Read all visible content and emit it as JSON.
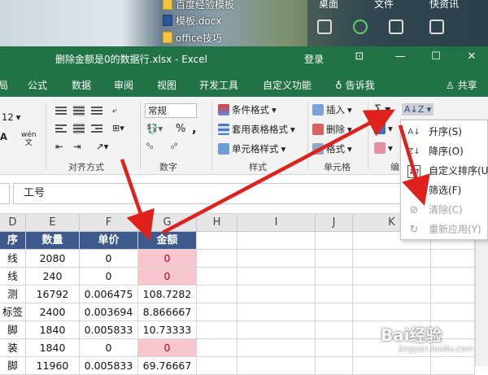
{
  "desktop": {
    "files": [
      "百度经验模板",
      "模板.docx",
      "office技巧"
    ],
    "widget_tabs": [
      "桌面",
      "文件",
      "快资讯"
    ]
  },
  "window": {
    "title": "删除金额是0的数据行.xlsx  -  Excel",
    "login": "登录"
  },
  "tabs": [
    "局",
    "公式",
    "数据",
    "审阅",
    "视图",
    "开发工具",
    "自定义功能",
    "告诉我",
    "共享"
  ],
  "ribbon": {
    "font_size_value": "12",
    "wen_label": "wén",
    "wen_sub": "文",
    "alignment_label": "对齐方式",
    "number_format": "常规",
    "percent": "%",
    "comma": ",",
    "number_label": "数字",
    "conditional_format": "条件格式",
    "table_format": "套用表格格式",
    "cell_style": "单元格样式",
    "styles_label": "样式",
    "insert": "插入",
    "delete": "删除",
    "format": "格式",
    "cells_label": "单元格",
    "editing_label": "编"
  },
  "formula_bar": {
    "value": "工号"
  },
  "grid": {
    "columns": [
      "D",
      "E",
      "F",
      "G",
      "H",
      "I",
      "J",
      "K"
    ],
    "header_row": [
      "序",
      "数量",
      "单价",
      "金额"
    ],
    "rows": [
      [
        "线",
        "2080",
        "0",
        "0"
      ],
      [
        "线",
        "240",
        "0",
        "0"
      ],
      [
        "测",
        "16792",
        "0.006475",
        "108.7282"
      ],
      [
        "标签",
        "2400",
        "0.003694",
        "8.866667"
      ],
      [
        "脚",
        "1840",
        "0.005833",
        "10.73333"
      ],
      [
        "装",
        "1840",
        "0",
        "0"
      ],
      [
        "脚",
        "11960",
        "0.005833",
        "69.76667"
      ]
    ]
  },
  "sort_menu": {
    "items": [
      {
        "label": "升序(S)",
        "icon": "sort-asc-icon",
        "enabled": true
      },
      {
        "label": "降序(O)",
        "icon": "sort-desc-icon",
        "enabled": true
      },
      {
        "label": "自定义排序(U)",
        "icon": "custom-sort-icon",
        "enabled": true
      },
      {
        "label": "筛选(F)",
        "icon": "filter-icon",
        "enabled": true
      },
      {
        "label": "清除(C)",
        "icon": "clear-filter-icon",
        "enabled": false
      },
      {
        "label": "重新应用(Y)",
        "icon": "reapply-icon",
        "enabled": false
      }
    ]
  },
  "watermark": {
    "text": "Bai经验",
    "sub": "jingyan.baidu.com"
  },
  "colors": {
    "excel_green": "#217346",
    "header_blue": "#3e5a8c",
    "zero_highlight": "#f8c6cf",
    "arrow_red": "#e0201a"
  }
}
